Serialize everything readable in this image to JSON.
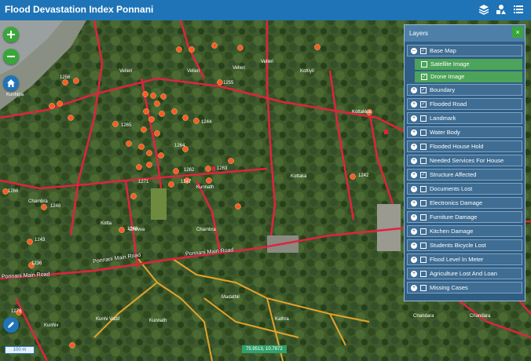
{
  "topbar": {
    "title": "Flood Devastation Index Ponnani"
  },
  "map": {
    "scale_label": "100 m",
    "coordinates": "75.9513, 10.7872",
    "road_labels": [
      "Ponnani Main Road",
      "Ponnani Main Road",
      "Ponnani Main Road"
    ],
    "place_labels": [
      "Kunhipa",
      "Velleri",
      "Velleri",
      "Velleri",
      "Velleri",
      "Kottiyil",
      "Kottaka",
      "Kottakkal",
      "Kunnath",
      "Chambra",
      "Kotta",
      "Chovva",
      "Chambra",
      "Kunhiv",
      "Kunhi Vattil",
      "Kunnath",
      "Kathra",
      "Chandara",
      "Chandara",
      "Madathil"
    ],
    "house_labels": [
      "1256",
      "1255",
      "1265",
      "1244",
      "1264",
      "1266",
      "1262",
      "1263",
      "1271",
      "1247",
      "1242",
      "1248",
      "1246",
      "1243",
      "1236",
      "1278"
    ]
  },
  "layers": {
    "title": "Layers",
    "close": "×",
    "base_map": {
      "label": "Base Map",
      "checked": true,
      "children": [
        {
          "label": "Satellite Image",
          "checked": false
        },
        {
          "label": "Drone Image",
          "checked": true
        }
      ]
    },
    "items": [
      {
        "label": "Boundary",
        "checked": true
      },
      {
        "label": "Flooded Road",
        "checked": true
      },
      {
        "label": "Landmark",
        "checked": false
      },
      {
        "label": "Water Body",
        "checked": false
      },
      {
        "label": "Flooded House Hold",
        "checked": false
      },
      {
        "label": "Needed Services For House",
        "checked": false
      },
      {
        "label": "Structure Affected",
        "checked": true
      },
      {
        "label": "Documents Lost",
        "checked": false
      },
      {
        "label": "Electronics Damage",
        "checked": false
      },
      {
        "label": "Furniture Damage",
        "checked": false
      },
      {
        "label": "Kitchen Damage",
        "checked": false
      },
      {
        "label": "Students Bicycle Lost",
        "checked": false
      },
      {
        "label": "Flood Level In Meter",
        "checked": false
      },
      {
        "label": "Agriculture Lost And Loan",
        "checked": false
      },
      {
        "label": "Missing Cases",
        "checked": false
      }
    ]
  },
  "icons": {
    "layers": "layers-icon",
    "shapes": "shapes-icon",
    "list": "list-icon",
    "zoom_in": "zoom-in-icon",
    "zoom_out": "zoom-out-icon",
    "home": "home-icon",
    "edit": "pencil-icon"
  },
  "colors": {
    "topbar": "#1f74b8",
    "panel": "#2f5d84",
    "accent": "#3aa63a",
    "marker": "#ff5a1f",
    "road": "#e0233f",
    "path": "#e4a32b"
  }
}
